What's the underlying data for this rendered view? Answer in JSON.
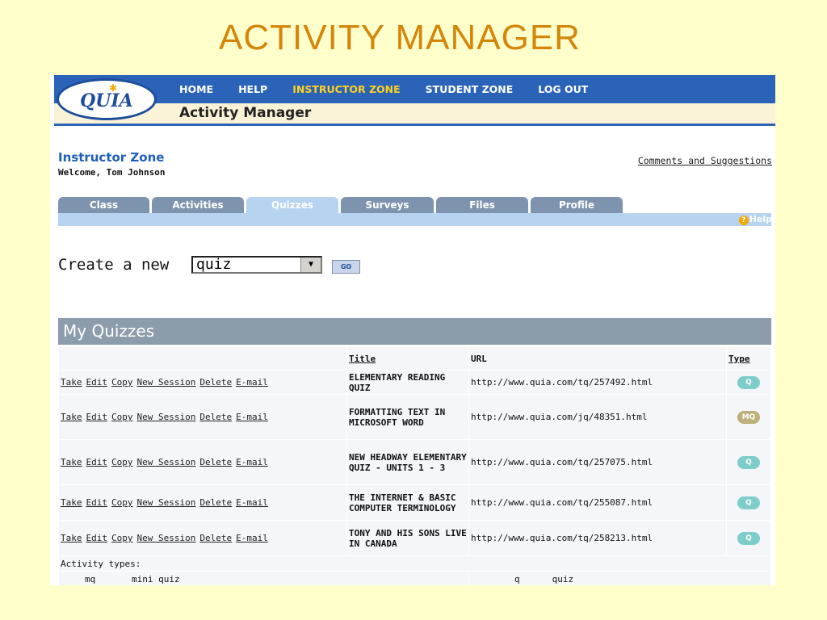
{
  "slide_title": "ACTIVITY MANAGER",
  "header": {
    "logo_text": "QUIA",
    "nav": [
      {
        "label": "HOME",
        "active": false
      },
      {
        "label": "HELP",
        "active": false
      },
      {
        "label": "INSTRUCTOR ZONE",
        "active": true
      },
      {
        "label": "STUDENT ZONE",
        "active": false
      },
      {
        "label": "LOG OUT",
        "active": false
      }
    ],
    "subtitle": "Activity Manager"
  },
  "zone": {
    "title": "Instructor Zone",
    "welcome": "Welcome, Tom Johnson",
    "comments_link": "Comments and Suggestions"
  },
  "tabs": [
    {
      "label": "Class"
    },
    {
      "label": "Activities"
    },
    {
      "label": "Quizzes",
      "active": true
    },
    {
      "label": "Surveys"
    },
    {
      "label": "Files"
    },
    {
      "label": "Profile"
    }
  ],
  "help_label": "Help",
  "create": {
    "label": "Create a new",
    "selected": "quiz",
    "go_label": "GO"
  },
  "my_quizzes": {
    "heading": "My Quizzes",
    "columns": {
      "title": "Title",
      "url": "URL",
      "type": "Type"
    },
    "action_labels": [
      "Take",
      "Edit",
      "Copy",
      "New Session",
      "Delete",
      "E-mail"
    ],
    "rows": [
      {
        "title": "ELEMENTARY READING QUIZ",
        "url": "http://www.quia.com/tq/257492.html",
        "type": "Q"
      },
      {
        "title": "FORMATTING TEXT IN MICROSOFT WORD",
        "url": "http://www.quia.com/jq/48351.html",
        "type": "MQ"
      },
      {
        "title": "NEW HEADWAY ELEMENTARY QUIZ - UNITS 1 - 3",
        "url": "http://www.quia.com/tq/257075.html",
        "type": "Q"
      },
      {
        "title": "THE INTERNET & BASIC COMPUTER TERMINOLOGY",
        "url": "http://www.quia.com/tq/255087.html",
        "type": "Q"
      },
      {
        "title": "TONY AND HIS SONS LIVE IN CANADA",
        "url": "http://www.quia.com/tq/258213.html",
        "type": "Q"
      }
    ],
    "activity_types_label": "Activity types:",
    "legend": [
      {
        "code": "mq",
        "name": "mini quiz"
      },
      {
        "code": "q",
        "name": "quiz"
      }
    ]
  },
  "colors": {
    "accent": "#2B63B8",
    "slide_bg": "#FFFFCC",
    "title": "#D4860B",
    "badge_q": "#7FCDCB",
    "badge_mq": "#BDB07A"
  }
}
